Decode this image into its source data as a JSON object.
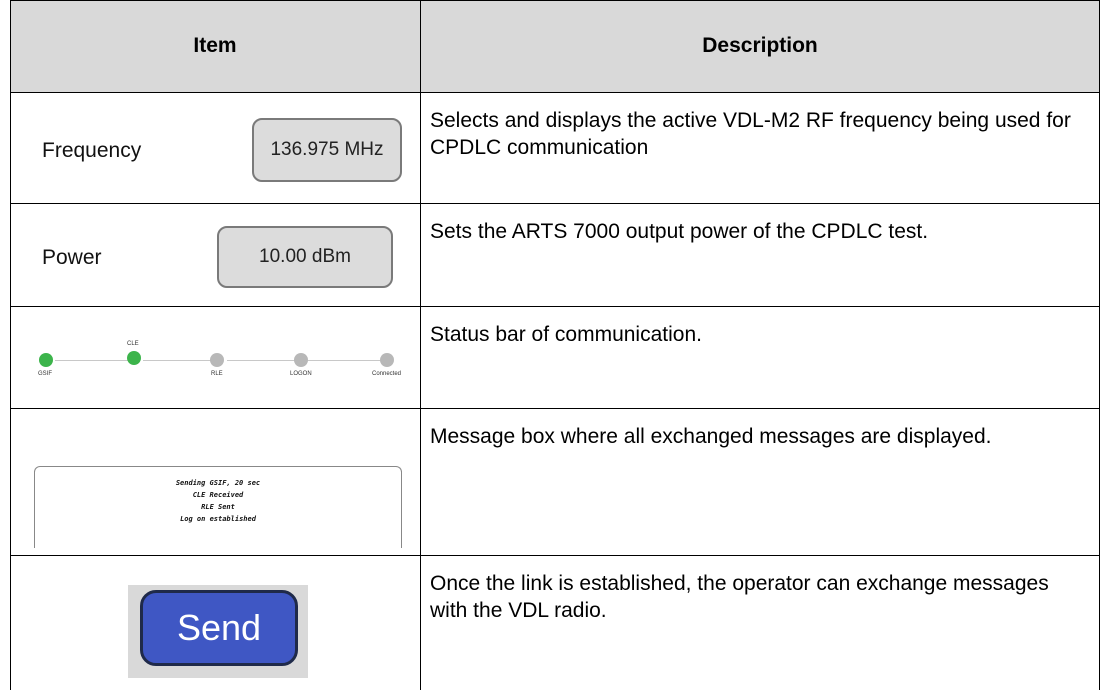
{
  "header": {
    "item": "Item",
    "description": "Description"
  },
  "rows": {
    "frequency": {
      "label": "Frequency",
      "value": "136.975 MHz",
      "description": "Selects and displays the active VDL-M2 RF frequency being used for CPDLC communication"
    },
    "power": {
      "label": "Power",
      "value": "10.00 dBm",
      "description": "Sets the ARTS 7000 output power of the CPDLC test."
    },
    "status": {
      "steps": [
        {
          "label": "GSIF",
          "active": true
        },
        {
          "label": "CLE",
          "active": true
        },
        {
          "label": "RLE",
          "active": false
        },
        {
          "label": "LOGON",
          "active": false
        },
        {
          "label": "Connected",
          "active": false
        }
      ],
      "description": "Status bar of communication.",
      "colors": {
        "active": "#3cb44b",
        "inactive": "#b8b8b8"
      }
    },
    "messages": {
      "lines": [
        "Sending GSIF, 20 sec",
        "CLE Received",
        "RLE Sent",
        "Log on established"
      ],
      "description": "Message box where all exchanged messages are displayed."
    },
    "send": {
      "label": "Send",
      "description": "Once the link is established, the operator can exchange messages with the VDL radio.",
      "color": "#3f57c4"
    }
  }
}
